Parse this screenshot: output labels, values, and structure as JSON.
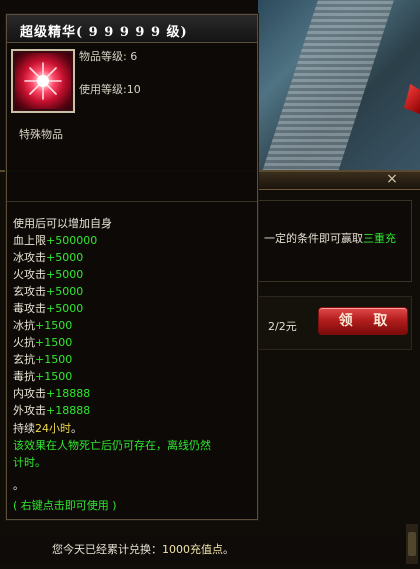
{
  "background": {
    "close_icon": "×",
    "desc_line_prefix": "一定的条件即可赢取",
    "desc_line_highlight": "三重充",
    "quantity": "2/2元",
    "claim_button": "领 取",
    "bottom_prefix": "您今天已经累计兑换：",
    "bottom_amount": "1000充值点",
    "bottom_suffix": "。"
  },
  "tooltip": {
    "title": "超级精华( 9 9 9 9 9 级)",
    "icon": "red-orb-icon",
    "item_level": "物品等级: 6",
    "use_level": "使用等级:10",
    "category": "特殊物品",
    "effect_intro": "使用后可以增加自身",
    "stats": [
      {
        "label": "血上限",
        "value": "+500000"
      },
      {
        "label": "冰攻击",
        "value": "+5000"
      },
      {
        "label": "火攻击",
        "value": "+5000"
      },
      {
        "label": "玄攻击",
        "value": "+5000"
      },
      {
        "label": "毒攻击",
        "value": "+5000"
      },
      {
        "label": "冰抗",
        "value": "+1500"
      },
      {
        "label": "火抗",
        "value": "+1500"
      },
      {
        "label": "玄抗",
        "value": "+1500"
      },
      {
        "label": "毒抗",
        "value": "+1500"
      },
      {
        "label": "内攻击",
        "value": "+18888"
      },
      {
        "label": "外攻击",
        "value": "+18888"
      }
    ],
    "duration_prefix": "持续",
    "duration_value": "24小时",
    "duration_suffix": "。",
    "persist_line1": "该效果在人物死亡后仍可存在，离线仍然",
    "persist_line2": "计时。",
    "dot": "。",
    "usage_hint": "( 右键点击即可使用 )"
  }
}
